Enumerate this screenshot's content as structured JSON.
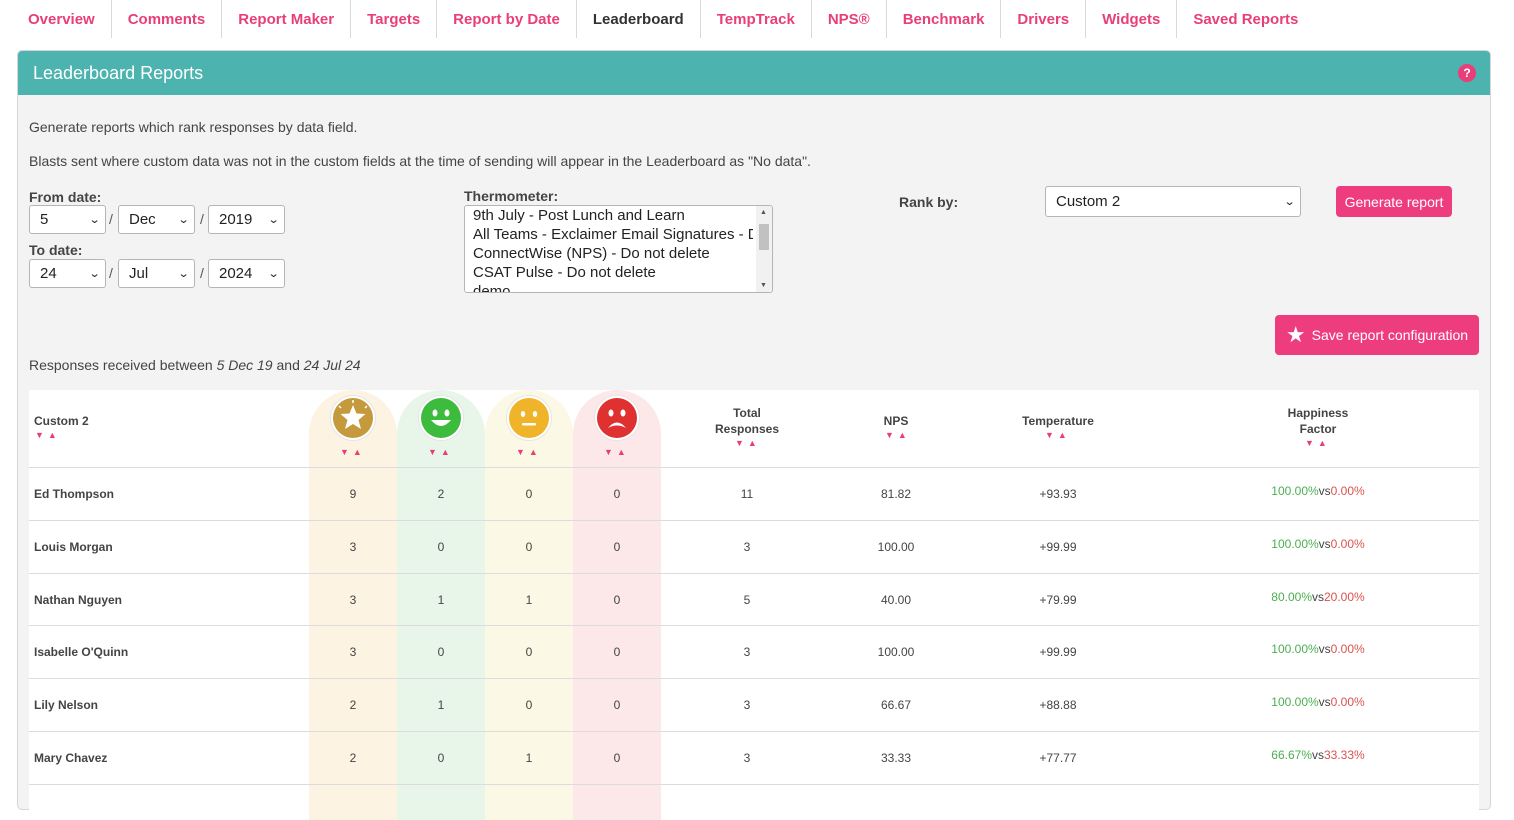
{
  "tabs": [
    {
      "label": "Overview",
      "active": false
    },
    {
      "label": "Comments",
      "active": false
    },
    {
      "label": "Report Maker",
      "active": false
    },
    {
      "label": "Targets",
      "active": false
    },
    {
      "label": "Report by Date",
      "active": false
    },
    {
      "label": "Leaderboard",
      "active": true
    },
    {
      "label": "TempTrack",
      "active": false
    },
    {
      "label": "NPS®",
      "active": false
    },
    {
      "label": "Benchmark",
      "active": false
    },
    {
      "label": "Drivers",
      "active": false
    },
    {
      "label": "Widgets",
      "active": false
    },
    {
      "label": "Saved Reports",
      "active": false
    }
  ],
  "panel": {
    "title": "Leaderboard Reports",
    "help": "?",
    "intro1": "Generate reports which rank responses by data field.",
    "intro2": "Blasts sent where custom data was not in the custom fields at the time of sending will appear in the Leaderboard as \"No data\"."
  },
  "form": {
    "from_label": "From date:",
    "from": {
      "day": "5",
      "month": "Dec",
      "year": "2019"
    },
    "to_label": "To date:",
    "to": {
      "day": "24",
      "month": "Jul",
      "year": "2024"
    },
    "slash": "/",
    "thermo_label": "Thermometer:",
    "thermo_options": [
      "9th July - Post Lunch and Learn",
      "All Teams - Exclaimer Email Signatures - Do not delete",
      "ConnectWise (NPS) - Do not delete",
      "CSAT Pulse - Do not delete",
      "demo"
    ],
    "rank_label": "Rank by:",
    "rank_value": "Custom 2",
    "generate_label": "Generate report",
    "save_label": "Save report configuration"
  },
  "responses": {
    "prefix": "Responses received between",
    "from": "5 Dec 19",
    "and": "and",
    "to": "24 Jul 24"
  },
  "table": {
    "headers": {
      "name": "Custom 2",
      "total1": "Total",
      "total2": "Responses",
      "nps": "NPS",
      "temperature": "Temperature",
      "happiness1": "Happiness",
      "happiness2": "Factor"
    },
    "sort_glyphs": {
      "down": "▼",
      "up": "▲"
    },
    "face_colors": {
      "star": "#c49a3c",
      "happy": "#3dbb3d",
      "neutral": "#f0b42a",
      "sad": "#e03131"
    },
    "column_colors": {
      "star": "#fcf3e3",
      "happy": "#e8f6ea",
      "neutral": "#fbf8e5",
      "sad": "#fce8e8"
    },
    "vs": "vs",
    "rows": [
      {
        "name": "Ed Thompson",
        "c1": "9",
        "c2": "2",
        "c3": "0",
        "c4": "0",
        "total": "11",
        "nps": "81.82",
        "temp": "+93.93",
        "hf_pos": "100.00%",
        "hf_neg": "0.00%"
      },
      {
        "name": "Louis Morgan",
        "c1": "3",
        "c2": "0",
        "c3": "0",
        "c4": "0",
        "total": "3",
        "nps": "100.00",
        "temp": "+99.99",
        "hf_pos": "100.00%",
        "hf_neg": "0.00%"
      },
      {
        "name": "Nathan Nguyen",
        "c1": "3",
        "c2": "1",
        "c3": "1",
        "c4": "0",
        "total": "5",
        "nps": "40.00",
        "temp": "+79.99",
        "hf_pos": "80.00%",
        "hf_neg": "20.00%"
      },
      {
        "name": "Isabelle O'Quinn",
        "c1": "3",
        "c2": "0",
        "c3": "0",
        "c4": "0",
        "total": "3",
        "nps": "100.00",
        "temp": "+99.99",
        "hf_pos": "100.00%",
        "hf_neg": "0.00%"
      },
      {
        "name": "Lily Nelson",
        "c1": "2",
        "c2": "1",
        "c3": "0",
        "c4": "0",
        "total": "3",
        "nps": "66.67",
        "temp": "+88.88",
        "hf_pos": "100.00%",
        "hf_neg": "0.00%"
      },
      {
        "name": "Mary Chavez",
        "c1": "2",
        "c2": "0",
        "c3": "1",
        "c4": "0",
        "total": "3",
        "nps": "33.33",
        "temp": "+77.77",
        "hf_pos": "66.67%",
        "hf_neg": "33.33%"
      }
    ]
  }
}
